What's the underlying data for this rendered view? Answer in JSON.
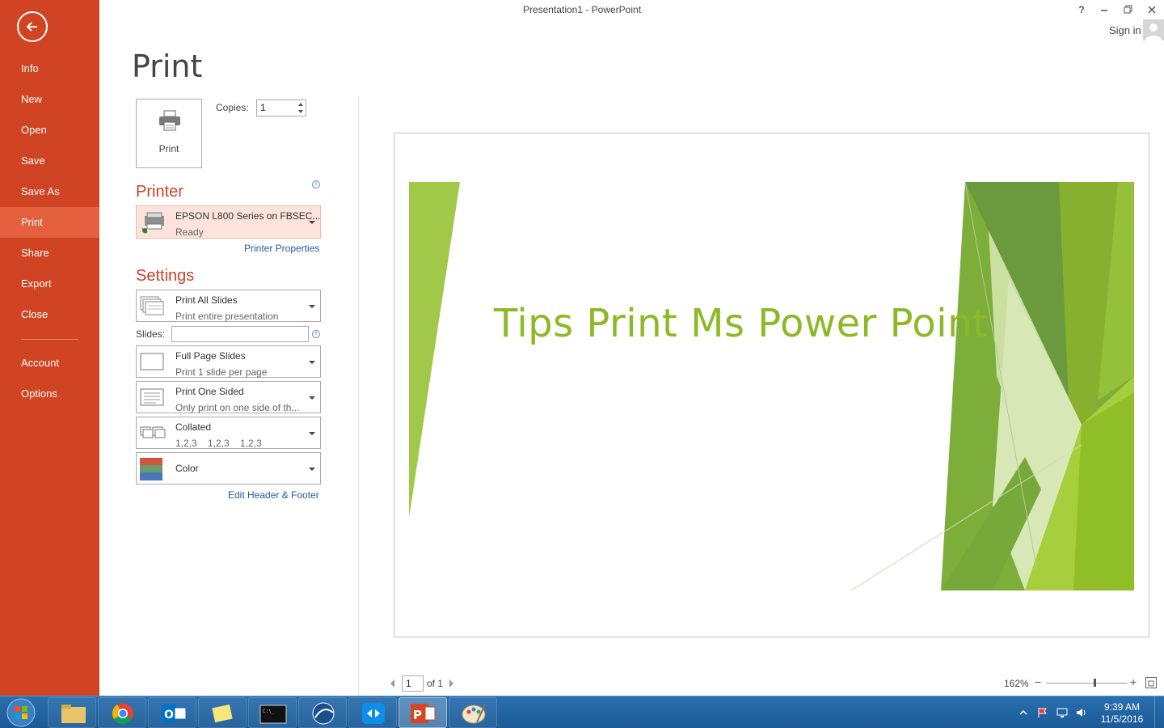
{
  "window": {
    "title": "Presentation1 - PowerPoint",
    "help_label": "?",
    "sign_in": "Sign in"
  },
  "sidebar": {
    "items": [
      {
        "label": "Info"
      },
      {
        "label": "New"
      },
      {
        "label": "Open"
      },
      {
        "label": "Save"
      },
      {
        "label": "Save As"
      },
      {
        "label": "Print"
      },
      {
        "label": "Share"
      },
      {
        "label": "Export"
      },
      {
        "label": "Close"
      },
      {
        "label": "Account"
      },
      {
        "label": "Options"
      }
    ],
    "active": "Print"
  },
  "print": {
    "heading": "Print",
    "button_label": "Print",
    "copies_label": "Copies:",
    "copies_value": "1"
  },
  "printer": {
    "heading": "Printer",
    "name": "EPSON L800 Series on FBSEC...",
    "status": "Ready",
    "properties_link": "Printer Properties"
  },
  "settings": {
    "heading": "Settings",
    "range": {
      "title": "Print All Slides",
      "subtitle": "Print entire presentation"
    },
    "slides_label": "Slides:",
    "slides_value": "",
    "layout": {
      "title": "Full Page Slides",
      "subtitle": "Print 1 slide per page"
    },
    "sides": {
      "title": "Print One Sided",
      "subtitle": "Only print on one side of th..."
    },
    "collation": {
      "title": "Collated",
      "subtitle": "1,2,3    1,2,3    1,2,3"
    },
    "color": {
      "title": "Color"
    },
    "header_footer_link": "Edit Header & Footer"
  },
  "preview": {
    "slide_title": "Tips Print Ms Power Point",
    "page_current": "1",
    "page_total": "of 1",
    "zoom": "162%",
    "zoom_level_percent": 162
  },
  "taskbar": {
    "apps": [
      "start-orb",
      "file-explorer",
      "chrome",
      "outlook",
      "sticky-notes",
      "command-prompt",
      "network-app",
      "teamviewer",
      "powerpoint",
      "paint"
    ],
    "time": "9:39 AM",
    "date": "11/5/2016"
  },
  "colors": {
    "backstage": "#D04424",
    "backstage_active": "#E5603F",
    "accent_text": "#C8432A",
    "slide_green": "#8DB927",
    "link": "#2B579A"
  }
}
